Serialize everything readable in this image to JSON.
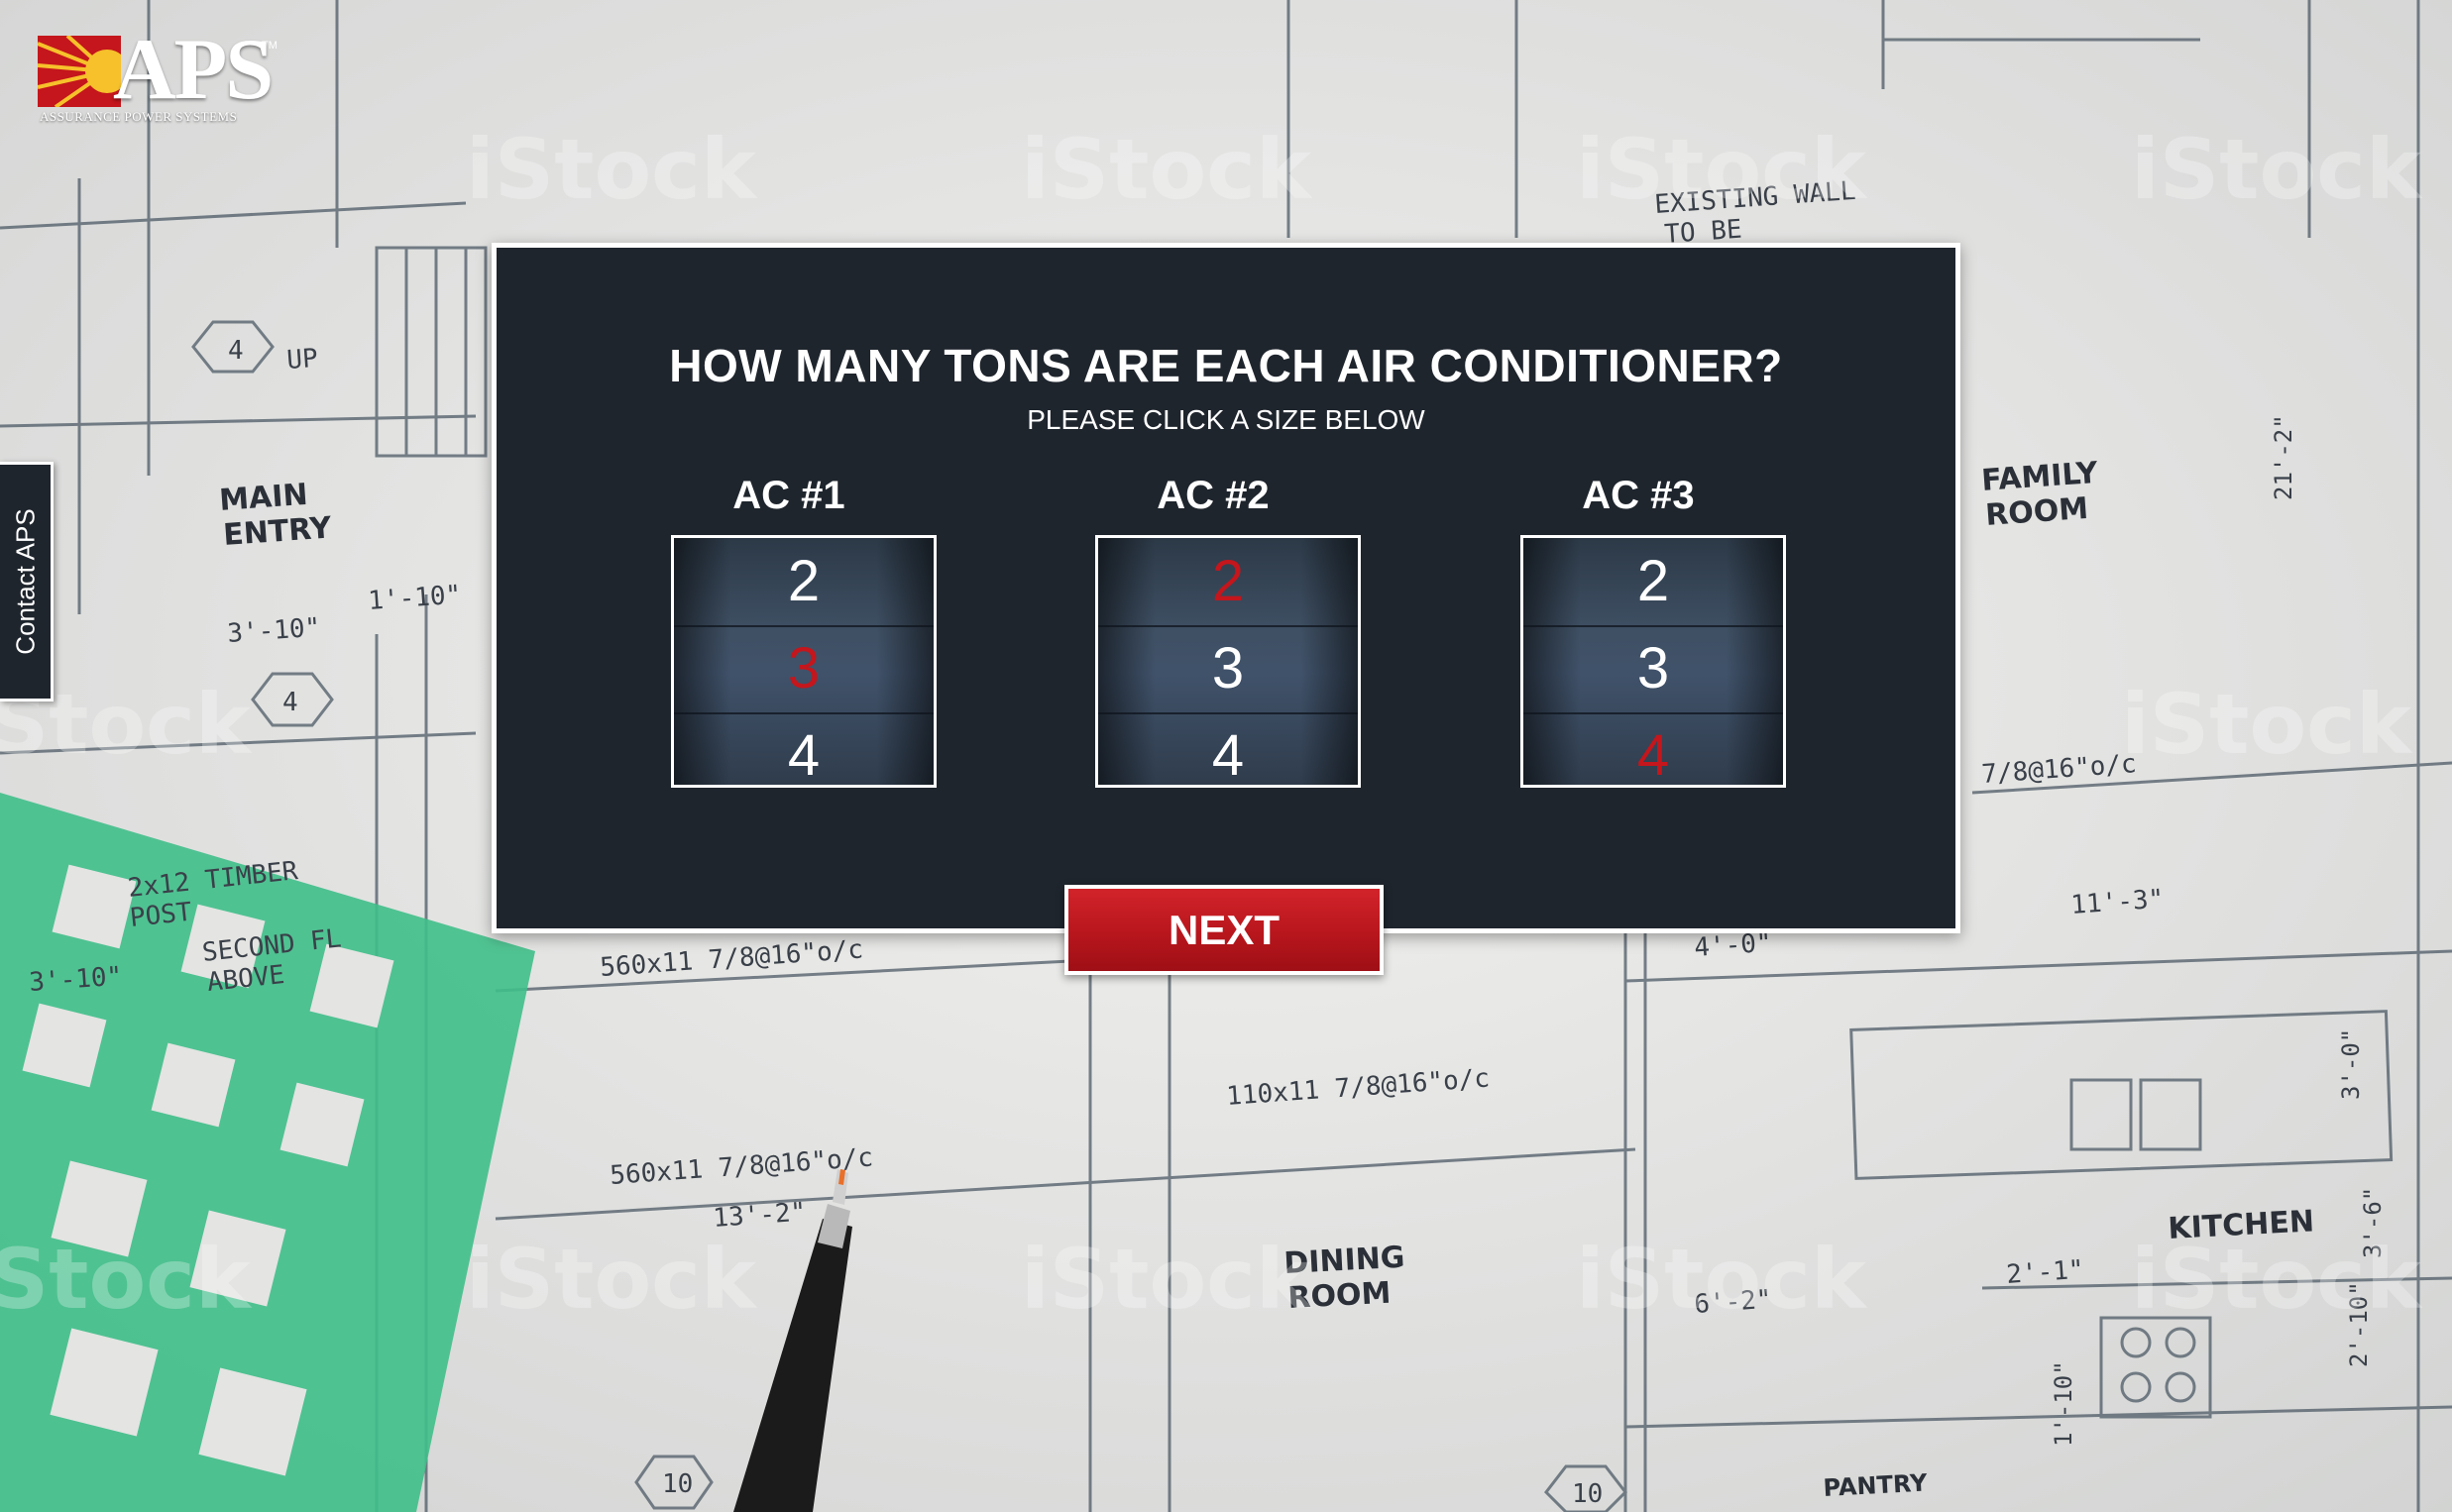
{
  "brand": {
    "logo_text": "APS",
    "tagline": "ASSURANCE POWER SYSTEMS",
    "trademark": "TM",
    "accent_color": "#c4161c",
    "panel_color": "#1f252d"
  },
  "contact_tab": {
    "label": "Contact APS"
  },
  "question": {
    "title": "HOW MANY TONS ARE EACH AIR CONDITIONER?",
    "subtitle": "PLEASE CLICK A SIZE BELOW"
  },
  "pickers": [
    {
      "label": "AC #1",
      "options": [
        "2",
        "3",
        "4"
      ],
      "selected": "3"
    },
    {
      "label": "AC #2",
      "options": [
        "2",
        "3",
        "4"
      ],
      "selected": "2"
    },
    {
      "label": "AC #3",
      "options": [
        "2",
        "3",
        "4"
      ],
      "selected": "4"
    }
  ],
  "next_button": {
    "label": "NEXT"
  },
  "background": {
    "description_labels": {
      "main_entry": [
        "MAIN",
        "ENTRY"
      ],
      "family_room": [
        "FAMILY",
        "ROOM"
      ],
      "dining_room": [
        "DINING",
        "ROOM"
      ],
      "kitchen": "KITCHEN",
      "pantry": "PANTRY",
      "existing_wall": [
        "EXISTING WALL",
        "TO BE"
      ],
      "timber": "2x12 TIMBER",
      "post": "POST",
      "second_fl": [
        "SECOND FL",
        "ABOVE"
      ],
      "beam1": "560x11 7/8@16\"o/c",
      "beam2": "560x11 7/8@16\"o/c",
      "beam3": "110x11 7/8@16\"o/c",
      "beam4": "7/8@16\"o/c",
      "dim1": "3'-10\"",
      "dim2": "1'-10\"",
      "dim3": "3'-10\"",
      "dim4": "13'-2\"",
      "dim5": "11'-3\"",
      "dim6": "4'-0\"",
      "dim7": "21'-2\"",
      "dim8": "3'-0\"",
      "dim9": "3'-6\"",
      "dim10": "2'-1\"",
      "dim11": "6'-2\"",
      "dim12": "2'-10\"",
      "dim13": "1'-10\"",
      "up": "UP",
      "hex4": "4",
      "hex10": "10",
      "watermark": "iStock"
    }
  }
}
